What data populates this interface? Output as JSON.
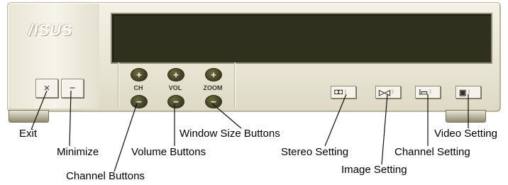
{
  "device": {
    "logo": "/ISUS",
    "window_buttons": {
      "exit": "×",
      "minimize": "−"
    },
    "controls": [
      {
        "id": "ch",
        "label": "CH",
        "plus": "+",
        "minus": "−"
      },
      {
        "id": "vol",
        "label": "VOL",
        "plus": "+",
        "minus": "−"
      },
      {
        "id": "zoom",
        "label": "ZOOM",
        "plus": "+",
        "minus": "−"
      }
    ],
    "function_buttons": [
      {
        "id": "stereo",
        "glyph": "◘◘",
        "dots": "⁞⁞"
      },
      {
        "id": "image",
        "glyph": "▷◁",
        "dots": "⁞⁞"
      },
      {
        "id": "channel",
        "glyph": "⁞▭",
        "dots": "⁞⁞"
      },
      {
        "id": "video",
        "glyph": "▣",
        "dots": "⁞⁞"
      }
    ]
  },
  "callouts": {
    "exit": "Exit",
    "minimize": "Minimize",
    "channel_buttons": "Channel Buttons",
    "volume_buttons": "Volume Buttons",
    "window_size_buttons": "Window Size Buttons",
    "stereo_setting": "Stereo  Setting",
    "image_setting": "Image Setting",
    "channel_setting": "Channel Setting",
    "video_setting": "Video Setting"
  },
  "colors": {
    "body": "#ebe8d8",
    "display": "#30301f",
    "knob": "#4a4a2a"
  }
}
